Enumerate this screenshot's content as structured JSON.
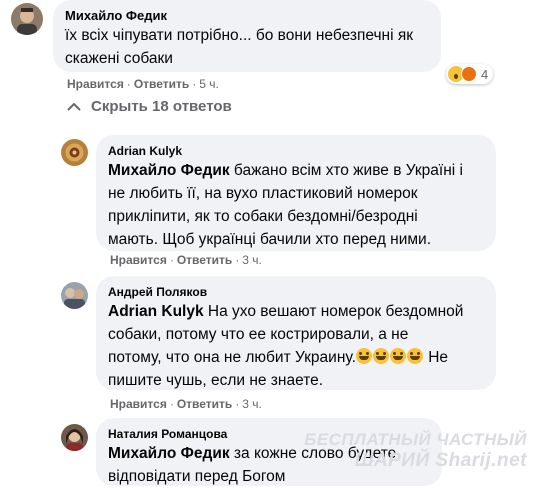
{
  "comment1": {
    "author": "Михайло Федик",
    "text_line1": "їх всіх чіпувати потрібно... бо вони небезпечні як",
    "text_line2": "скажені собаки",
    "like": "Нравится",
    "reply": "Ответить",
    "time": "5 ч.",
    "reaction_count": "4"
  },
  "hide_replies": "Скрыть 18 ответов",
  "reply1": {
    "author": "Adrian Kulyk",
    "mention": "Михайло Федик",
    "line1_rest": "бажано всім хто живе в Україні і",
    "line2": "не любить її, на вухо пластиковий номерок",
    "line3": "приклiпити, як то собаки бездомні/безродні",
    "line4": "мають. Щоб українці бачили хто перед ними.",
    "like": "Нравится",
    "reply": "Ответить",
    "time": "3 ч."
  },
  "reply2": {
    "author": "Андрей Поляков",
    "mention": "Adrian Kulyk",
    "line1_rest": "На ухо вешают номерок бездомной",
    "line2": "собаки, потому что ее кострировали, а не",
    "line3": "потому, что она не любит Украину.",
    "line3_end": "Не",
    "line4": "пишите чушь, если не знаете.",
    "like": "Нравится",
    "reply": "Ответить",
    "time": "3 ч."
  },
  "reply3": {
    "author": "Наталия Романцова",
    "mention": "Михайло Федик",
    "line1_rest": "за кожне слово будете",
    "line2": "відповідати перед Богом"
  },
  "watermark": {
    "line1": "БЕСПЛАТНЫЙ ЧАСТНЫЙ",
    "line2": "ШАРИЙ Sharij.net"
  }
}
